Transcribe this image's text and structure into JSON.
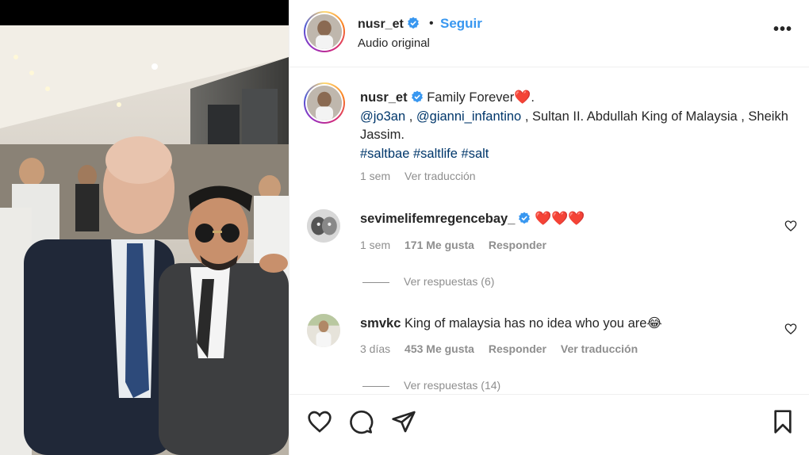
{
  "post": {
    "username": "nusr_et",
    "follow_label": "Seguir",
    "separator": "•",
    "audio_label": "Audio original",
    "more_icon": "more-horizontal-icon"
  },
  "caption": {
    "username": "nusr_et",
    "line1": "Family Forever",
    "heart": "❤️",
    "period": ".",
    "mention1": "@jo3an",
    "sep1": " , ",
    "mention2": "@gianni_infantino",
    "rest": " , Sultan II. Abdullah King of Malaysia , Sheikh Jassim.",
    "hashtag1": "#saltbae",
    "hashtag2": "#saltlife",
    "hashtag3": "#salt",
    "time": "1 sem",
    "translate": "Ver traducción"
  },
  "comments": [
    {
      "username": "sevimelifemregencebay_",
      "text": "❤️❤️❤️",
      "time": "1 sem",
      "likes": "171 Me gusta",
      "reply": "Responder",
      "replies": "Ver respuestas (6)"
    },
    {
      "username": "smvkc",
      "text": "King of malaysia has no idea who you are😂",
      "time": "3 días",
      "likes": "453 Me gusta",
      "reply": "Responder",
      "translate": "Ver traducción",
      "replies": "Ver respuestas (14)"
    }
  ],
  "actions": {
    "like_icon": "heart-icon",
    "comment_icon": "comment-icon",
    "share_icon": "paper-plane-icon",
    "save_icon": "bookmark-icon"
  },
  "colors": {
    "link": "#00376b",
    "follow": "#3897f0",
    "muted": "#8e8e8e",
    "verified": "#3897f0",
    "heart": "#ed1c24"
  }
}
